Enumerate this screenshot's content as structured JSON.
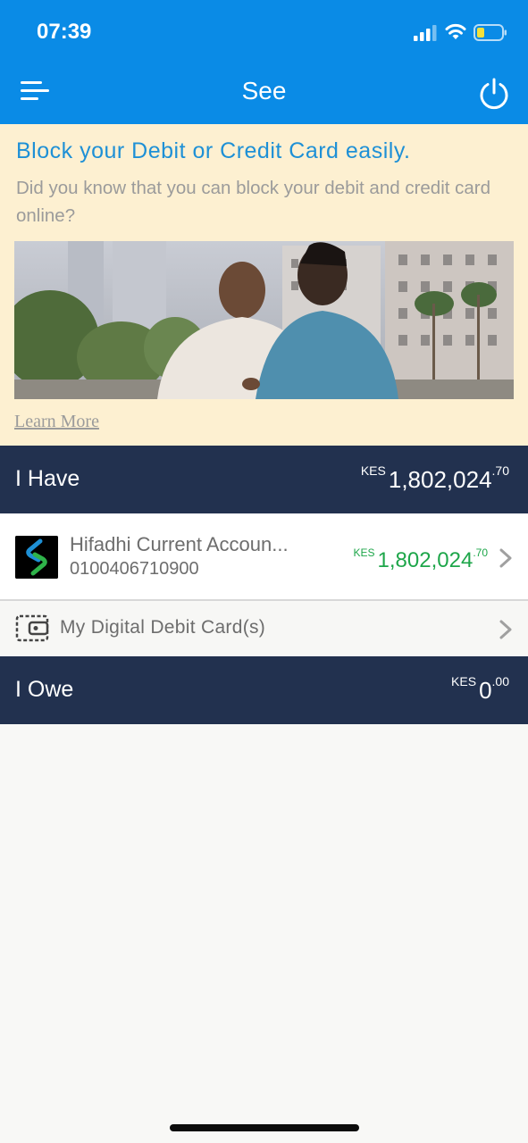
{
  "status_bar": {
    "time": "07:39"
  },
  "nav": {
    "title": "See"
  },
  "promo": {
    "title": "Block your Debit or Credit Card easily.",
    "text": "Did you know that you can block your debit and credit card online?",
    "learn_more": "Learn More"
  },
  "i_have": {
    "label": "I Have",
    "currency": "KES",
    "amount": "1,802,024",
    "cents": ".70"
  },
  "account": {
    "name": "Hifadhi Current Accoun...",
    "number": "0100406710900",
    "currency": "KES",
    "amount": "1,802,024",
    "cents": ".70"
  },
  "digital_card": {
    "label": "My Digital Debit Card(s)"
  },
  "i_owe": {
    "label": "I Owe",
    "currency": "KES",
    "amount": "0",
    "cents": ".00"
  },
  "colors": {
    "primary_blue": "#0a8be6",
    "navy": "#22314f",
    "promo_bg": "#fdf0d1",
    "positive_green": "#1ea64a"
  }
}
